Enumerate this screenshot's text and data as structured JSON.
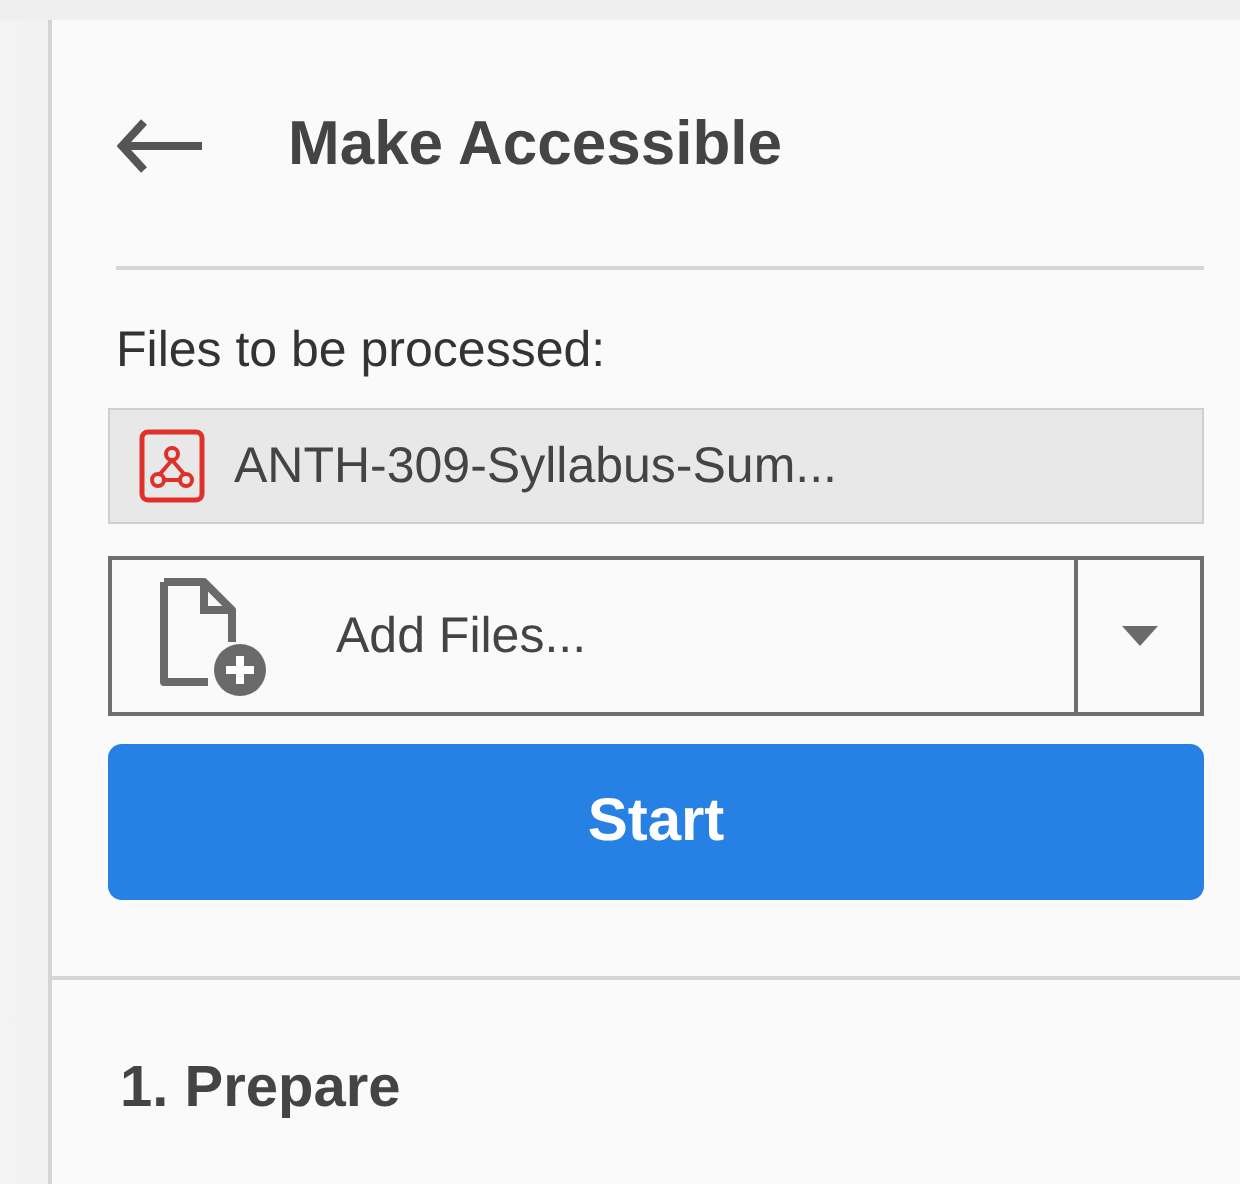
{
  "panel": {
    "title": "Make Accessible",
    "files_label": "Files to be processed:",
    "files": [
      {
        "name": "ANTH-309-Syllabus-Sum..."
      }
    ],
    "add_files": {
      "label": "Add Files..."
    },
    "start_button": "Start",
    "section": {
      "title": "1. Prepare"
    }
  }
}
